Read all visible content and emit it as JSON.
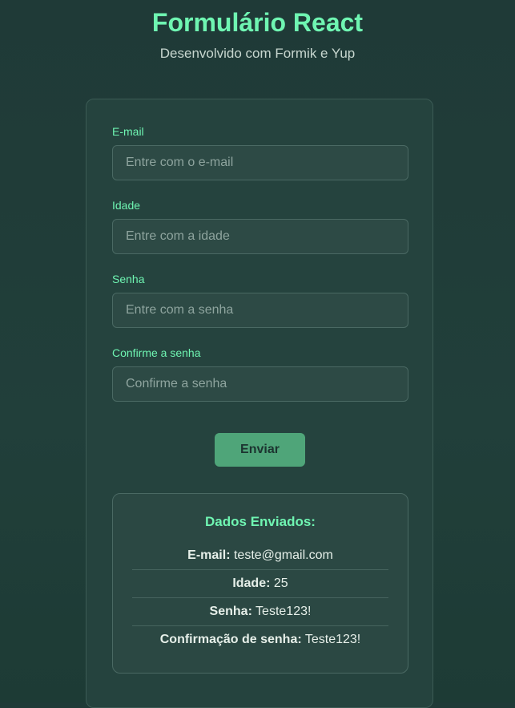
{
  "header": {
    "title": "Formulário React",
    "subtitle": "Desenvolvido com Formik e Yup"
  },
  "form": {
    "fields": [
      {
        "label": "E-mail",
        "placeholder": "Entre com o e-mail",
        "value": ""
      },
      {
        "label": "Idade",
        "placeholder": "Entre com a idade",
        "value": ""
      },
      {
        "label": "Senha",
        "placeholder": "Entre com a senha",
        "value": ""
      },
      {
        "label": "Confirme a senha",
        "placeholder": "Confirme a senha",
        "value": ""
      }
    ],
    "submit_label": "Enviar"
  },
  "results": {
    "title": "Dados Enviados:",
    "items": [
      {
        "key": "E-mail:",
        "value": "teste@gmail.com"
      },
      {
        "key": "Idade:",
        "value": "25"
      },
      {
        "key": "Senha:",
        "value": "Teste123!"
      },
      {
        "key": "Confirmação de senha:",
        "value": "Teste123!"
      }
    ]
  },
  "colors": {
    "accent": "#6ff5b2",
    "button": "#4fa579",
    "background": "#1f3a37"
  }
}
